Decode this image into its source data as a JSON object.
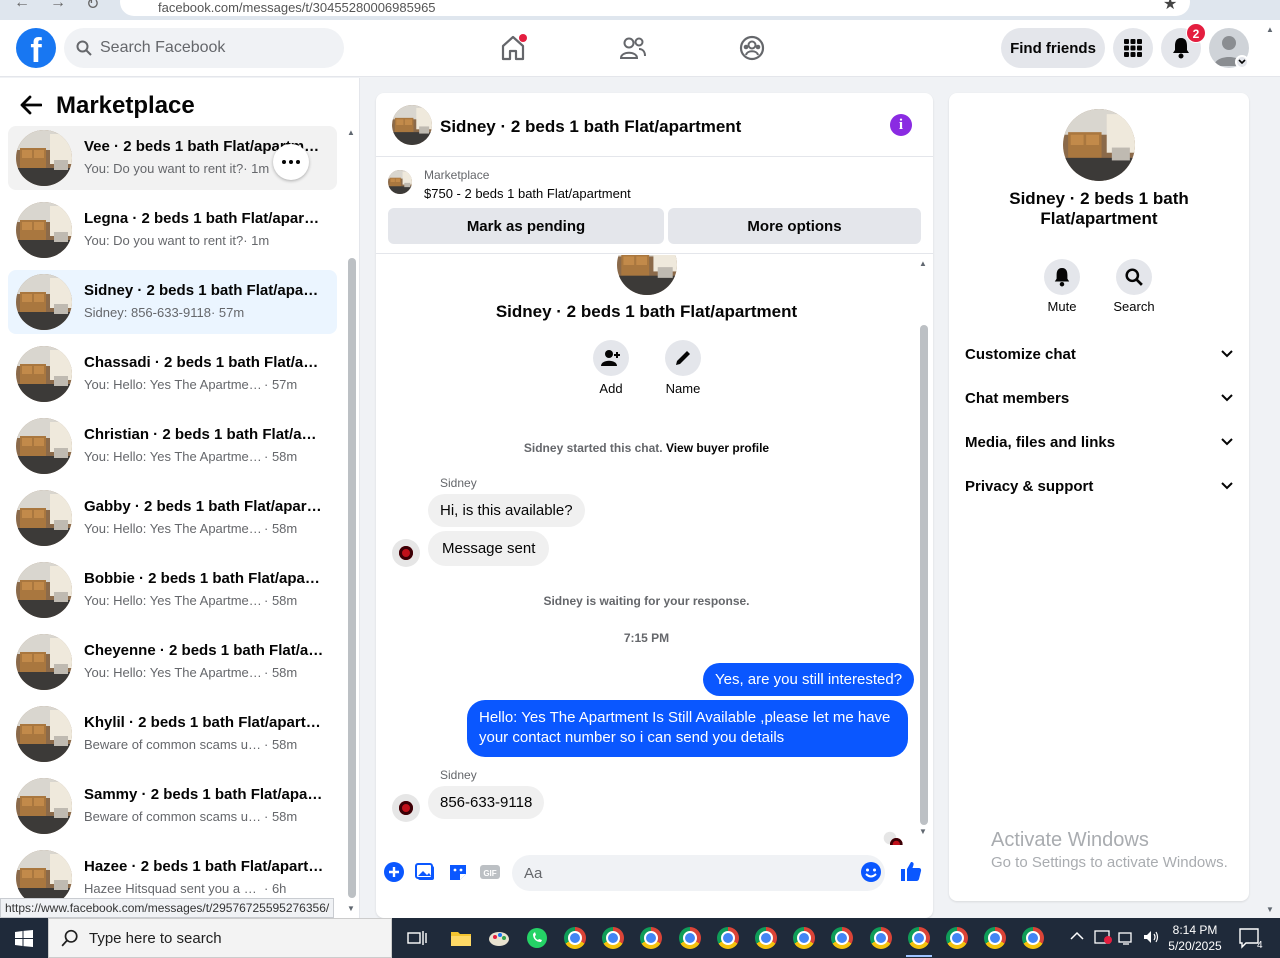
{
  "browser": {
    "url": "facebook.com/messages/t/30455280006985965"
  },
  "topbar": {
    "search_placeholder": "Search Facebook",
    "find_friends_label": "Find friends",
    "notifications_count": "2",
    "brand_color": "#1877f2"
  },
  "sidebar": {
    "title": "Marketplace",
    "conversations": [
      {
        "name": "Vee · 2 beds 1 bath Flat/apartment",
        "preview": "You: Do you want to rent it?",
        "time": "· 1m"
      },
      {
        "name": "Legna · 2 beds 1 bath Flat/apartment",
        "preview": "You: Do you want to rent it?",
        "time": "· 1m"
      },
      {
        "name": "Sidney · 2 beds 1 bath Flat/apartment",
        "preview": "Sidney: 856-633-9118",
        "time": "· 57m"
      },
      {
        "name": "Chassadi · 2 beds 1 bath Flat/apartment",
        "preview": "You: Hello: Yes The Apartment Is Still Available",
        "time": "· 57m"
      },
      {
        "name": "Christian · 2 beds 1 bath Flat/apartment",
        "preview": "You: Hello: Yes The Apartment Is Still Available",
        "time": "· 58m"
      },
      {
        "name": "Gabby · 2 beds 1 bath Flat/apartment",
        "preview": "You: Hello: Yes The Apartment Is Still Available",
        "time": "· 58m"
      },
      {
        "name": "Bobbie · 2 beds 1 bath Flat/apartment",
        "preview": "You: Hello: Yes The Apartment Is Still Available",
        "time": "· 58m"
      },
      {
        "name": "Cheyenne · 2 beds 1 bath Flat/apartment",
        "preview": "You: Hello: Yes The Apartment Is Still Available",
        "time": "· 58m"
      },
      {
        "name": "Khylil · 2 beds 1 bath Flat/apartment",
        "preview": "Beware of common scams using payment apps",
        "time": "· 58m"
      },
      {
        "name": "Sammy · 2 beds 1 bath Flat/apartment",
        "preview": "Beware of common scams using payment apps",
        "time": "· 58m"
      },
      {
        "name": "Hazee · 2 beds 1 bath Flat/apartment",
        "preview": "Hazee Hitsquad sent you a message",
        "time": "· 6h"
      }
    ],
    "status_url": "https://www.facebook.com/messages/t/29576725595276356/"
  },
  "chat": {
    "title": "Sidney · 2 beds 1 bath Flat/apartment",
    "marketplace_label": "Marketplace",
    "listing": "$750 - 2 beds 1 bath Flat/apartment",
    "mark_pending_label": "Mark as pending",
    "more_options_label": "More options",
    "add_label": "Add",
    "name_label": "Name",
    "started_text": "Sidney started this chat.",
    "view_profile_link": "View buyer profile",
    "sender_name": "Sidney",
    "msg_in_1": "Hi, is this available?",
    "msg_in_2": "Message sent",
    "waiting_text": "Sidney is waiting for your response.",
    "timestamp": "7:15 PM",
    "msg_out_1": "Yes, are you still interested?",
    "msg_out_2": "Hello: Yes The Apartment Is Still Available ,please let me have your contact number so i can send you details",
    "msg_in_3": "856-633-9118",
    "composer_placeholder": "Aa",
    "outgoing_color": "#0a57ff",
    "info_color": "#8a2be2"
  },
  "right_panel": {
    "title": "Sidney · 2 beds 1 bath Flat/apartment",
    "mute_label": "Mute",
    "search_label": "Search",
    "sections": [
      "Customize chat",
      "Chat members",
      "Media, files and links",
      "Privacy & support"
    ]
  },
  "watermark": {
    "line1": "Activate Windows",
    "line2": "Go to Settings to activate Windows."
  },
  "taskbar": {
    "search_placeholder": "Type here to search",
    "time": "8:14 PM",
    "date": "5/20/2025",
    "notification_count": "4"
  }
}
